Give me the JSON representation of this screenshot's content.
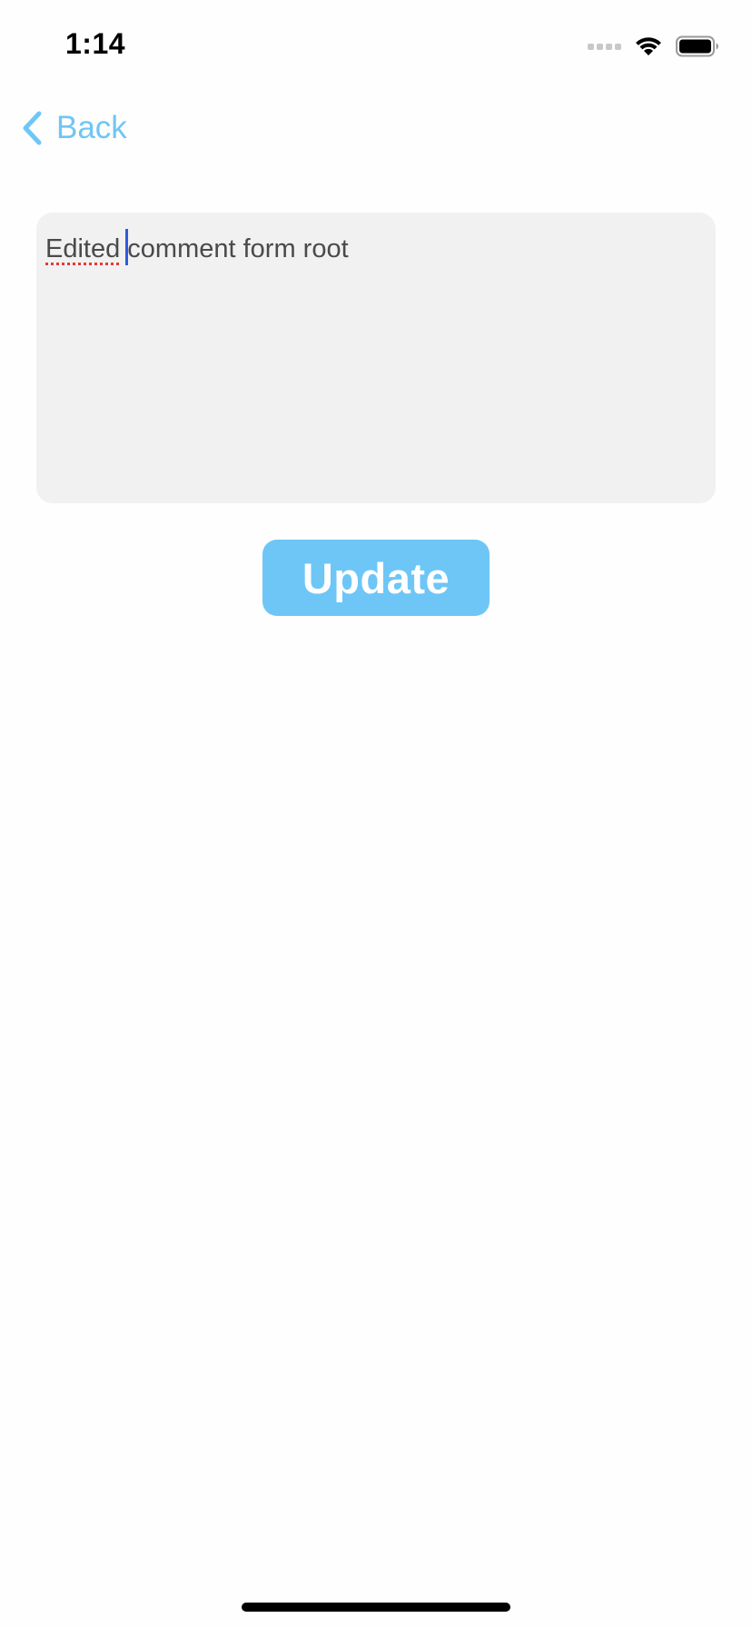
{
  "status_bar": {
    "time": "1:14",
    "signal_icon": "cellular-signal-icon",
    "wifi_icon": "wifi-icon",
    "battery_icon": "battery-icon"
  },
  "nav": {
    "back_label": "Back",
    "back_icon": "chevron-left-icon"
  },
  "comment": {
    "misspelled_word": "Edited",
    "text_before_caret": " ",
    "text_after_caret": "comment form root"
  },
  "actions": {
    "update_label": "Update"
  },
  "colors": {
    "accent": "#6ec6f5",
    "field_background": "#f1f1f1",
    "caret": "#2f5bdc",
    "spell_error": "#e53935"
  }
}
